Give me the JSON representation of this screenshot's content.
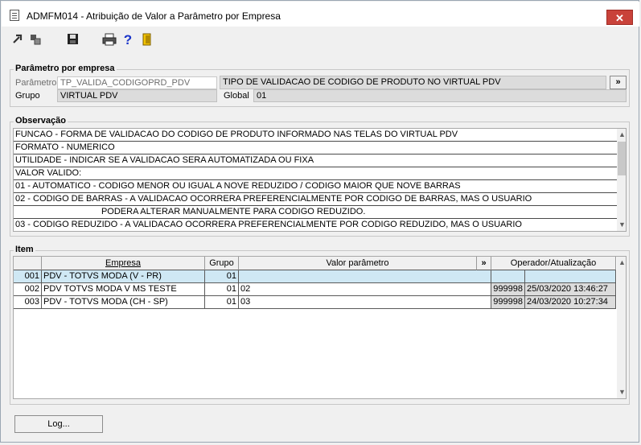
{
  "window": {
    "title": "ADMFM014 - Atribuição de Valor a Parâmetro por Empresa",
    "close_label": "✕"
  },
  "toolbar": {
    "icons": [
      "pin-icon",
      "copy-icon",
      "save-icon",
      "print-icon",
      "help-icon",
      "exit-icon"
    ],
    "help_glyph": "?"
  },
  "param_group": {
    "title": "Parâmetro por empresa",
    "param_label": "Parâmetro",
    "param_value": "TP_VALIDA_CODIGOPRD_PDV",
    "param_description": "TIPO DE VALIDACAO DE CODIGO DE PRODUTO NO VIRTUAL PDV",
    "expand_label": "»",
    "group_label": "Grupo",
    "group_value": "VIRTUAL PDV",
    "global_label": "Global",
    "global_value": "01"
  },
  "obs_group": {
    "title": "Observação",
    "lines": [
      "FUNCAO - FORMA DE VALIDACAO DO CODIGO DE PRODUTO INFORMADO NAS TELAS DO VIRTUAL PDV",
      "FORMATO - NUMERICO",
      "UTILIDADE - INDICAR SE A VALIDACAO SERA AUTOMATIZADA OU FIXA",
      "VALOR VALIDO:",
      " 01 - AUTOMATICO - CODIGO MENOR OU IGUAL A NOVE REDUZIDO / CODIGO MAIOR QUE NOVE BARRAS",
      " 02 - CODIGO DE BARRAS - A VALIDACAO OCORRERA PREFERENCIALMENTE POR CODIGO DE BARRAS, MAS O USUARIO",
      "                                   PODERA ALTERAR MANUALMENTE PARA CODIGO REDUZIDO.",
      " 03 - CODIGO REDUZIDO - A VALIDACAO OCORRERA PREFERENCIALMENTE POR CODIGO REDUZIDO, MAS O USUARIO"
    ]
  },
  "item_group": {
    "title": "Item",
    "headers": {
      "empresa": "Empresa",
      "grupo": "Grupo",
      "valor": "Valor parâmetro",
      "expand": "»",
      "operador": "Operador/Atualização"
    },
    "rows": [
      {
        "code": "001",
        "empresa": "PDV - TOTVS MODA (V - PR)",
        "grupo": "01",
        "valor": "",
        "operador": "",
        "atualizacao": ""
      },
      {
        "code": "002",
        "empresa": "PDV TOTVS MODA V MS TESTE",
        "grupo": "01",
        "valor": "02",
        "operador": "999998",
        "atualizacao": "25/03/2020 13:46:27"
      },
      {
        "code": "003",
        "empresa": "PDV - TOTVS MODA (CH - SP)",
        "grupo": "01",
        "valor": "03",
        "operador": "999998",
        "atualizacao": "24/03/2020 10:27:34"
      }
    ]
  },
  "footer": {
    "log_label": "Log..."
  }
}
